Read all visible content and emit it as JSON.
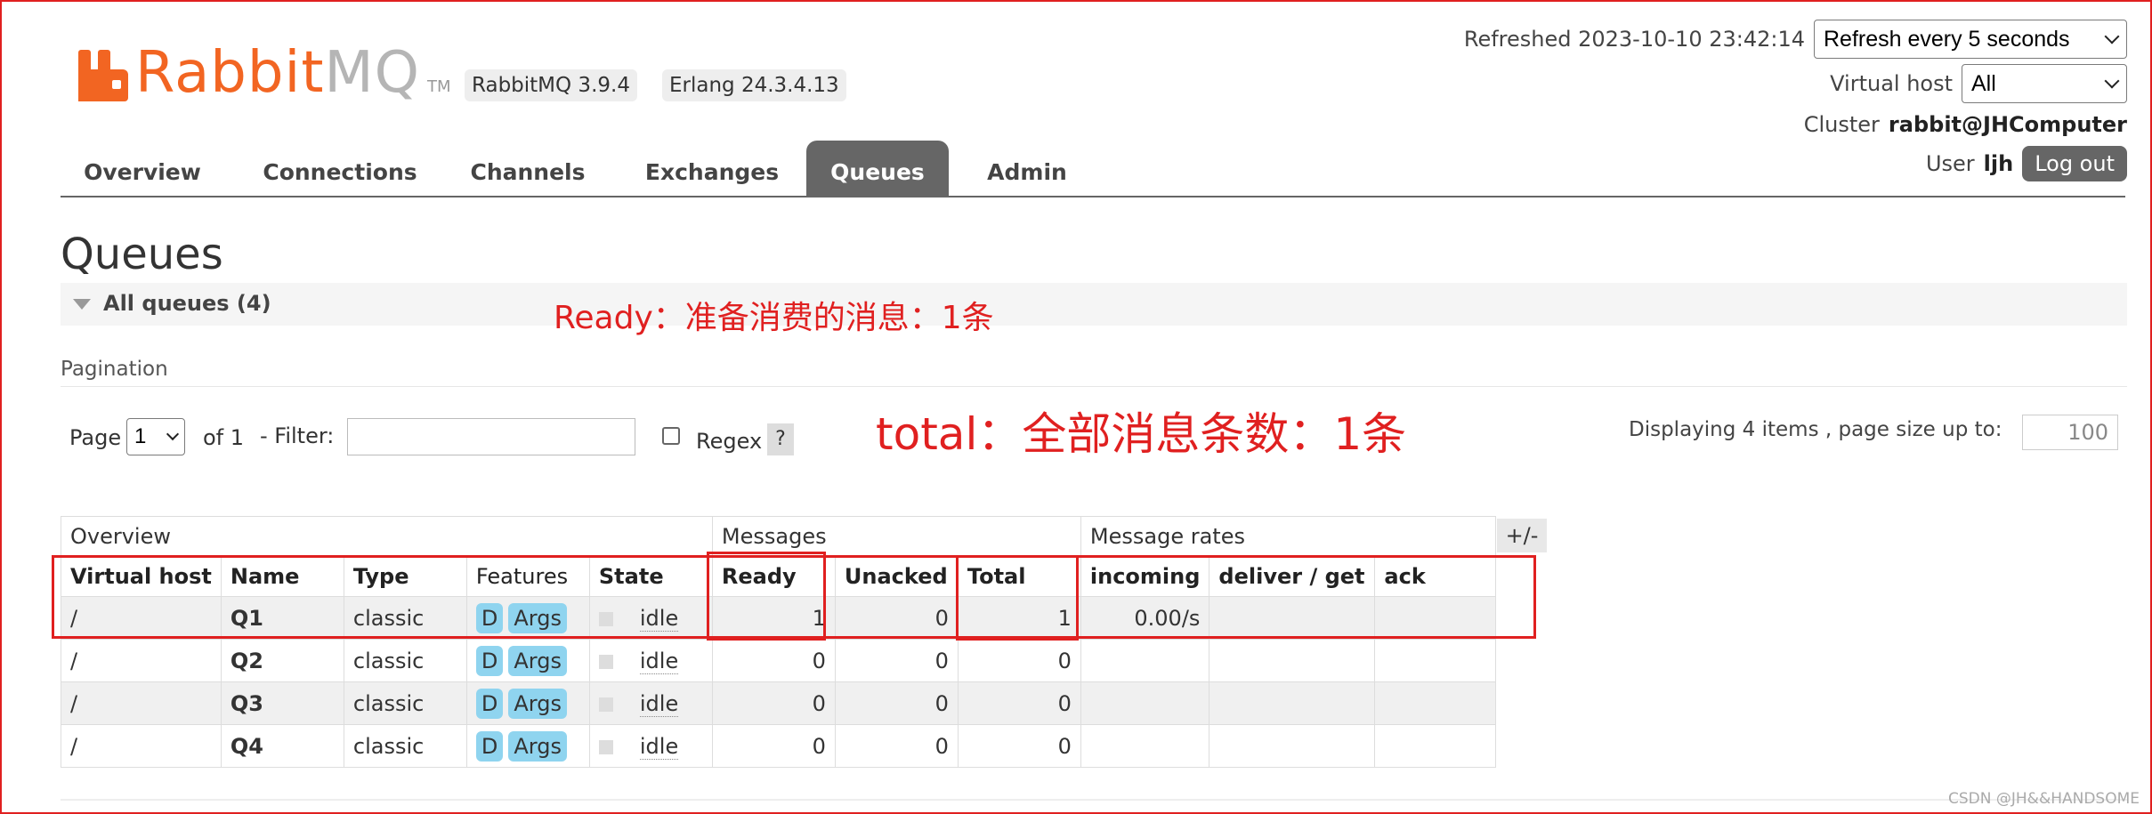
{
  "header": {
    "logo_rabbit": "Rabbit",
    "logo_mq": "MQ",
    "logo_tm": "TM",
    "version_badge": "RabbitMQ 3.9.4",
    "erlang_badge": "Erlang 24.3.4.13",
    "refreshed_text": "Refreshed 2023-10-10 23:42:14",
    "refresh_select_value": "Refresh every 5 seconds",
    "vhost_label": "Virtual host",
    "vhost_select_value": "All",
    "cluster_label": "Cluster",
    "cluster_value": "rabbit@JHComputer",
    "user_label": "User",
    "user_value": "ljh",
    "logout_label": "Log out"
  },
  "tabs": [
    {
      "label": "Overview"
    },
    {
      "label": "Connections"
    },
    {
      "label": "Channels"
    },
    {
      "label": "Exchanges"
    },
    {
      "label": "Queues",
      "active": true
    },
    {
      "label": "Admin"
    }
  ],
  "page": {
    "title": "Queues",
    "section_title": "All queues (4)"
  },
  "annotations": {
    "ready_note": "Ready：准备消费的消息：1条",
    "total_note": "total：全部消息条数：1条"
  },
  "pagination": {
    "label": "Pagination",
    "page_label": "Page",
    "page_value": "1",
    "of_label": "of 1",
    "filter_label": "- Filter:",
    "filter_value": "",
    "regex_label": "Regex",
    "help_label": "?",
    "displaying_text": "Displaying 4 items , page size up to:",
    "page_size_value": "100"
  },
  "table": {
    "groups": {
      "overview": "Overview",
      "messages": "Messages",
      "rates": "Message rates",
      "toggle": "+/-"
    },
    "headers": [
      "Virtual host",
      "Name",
      "Type",
      "Features",
      "State",
      "Ready",
      "Unacked",
      "Total",
      "incoming",
      "deliver / get",
      "ack"
    ],
    "feature_d": "D",
    "feature_args": "Args",
    "rows": [
      {
        "vhost": "/",
        "name": "Q1",
        "type": "classic",
        "state": "idle",
        "ready": "1",
        "unacked": "0",
        "total": "1",
        "incoming": "0.00/s",
        "deliver": "",
        "ack": ""
      },
      {
        "vhost": "/",
        "name": "Q2",
        "type": "classic",
        "state": "idle",
        "ready": "0",
        "unacked": "0",
        "total": "0",
        "incoming": "",
        "deliver": "",
        "ack": ""
      },
      {
        "vhost": "/",
        "name": "Q3",
        "type": "classic",
        "state": "idle",
        "ready": "0",
        "unacked": "0",
        "total": "0",
        "incoming": "",
        "deliver": "",
        "ack": ""
      },
      {
        "vhost": "/",
        "name": "Q4",
        "type": "classic",
        "state": "idle",
        "ready": "0",
        "unacked": "0",
        "total": "0",
        "incoming": "",
        "deliver": "",
        "ack": ""
      }
    ]
  },
  "watermark": "CSDN @JH&&HANDSOME",
  "colors": {
    "brand": "#f26522",
    "annotation": "#e02020",
    "tab_active": "#666666",
    "feature_pill": "#8fd4ef"
  }
}
